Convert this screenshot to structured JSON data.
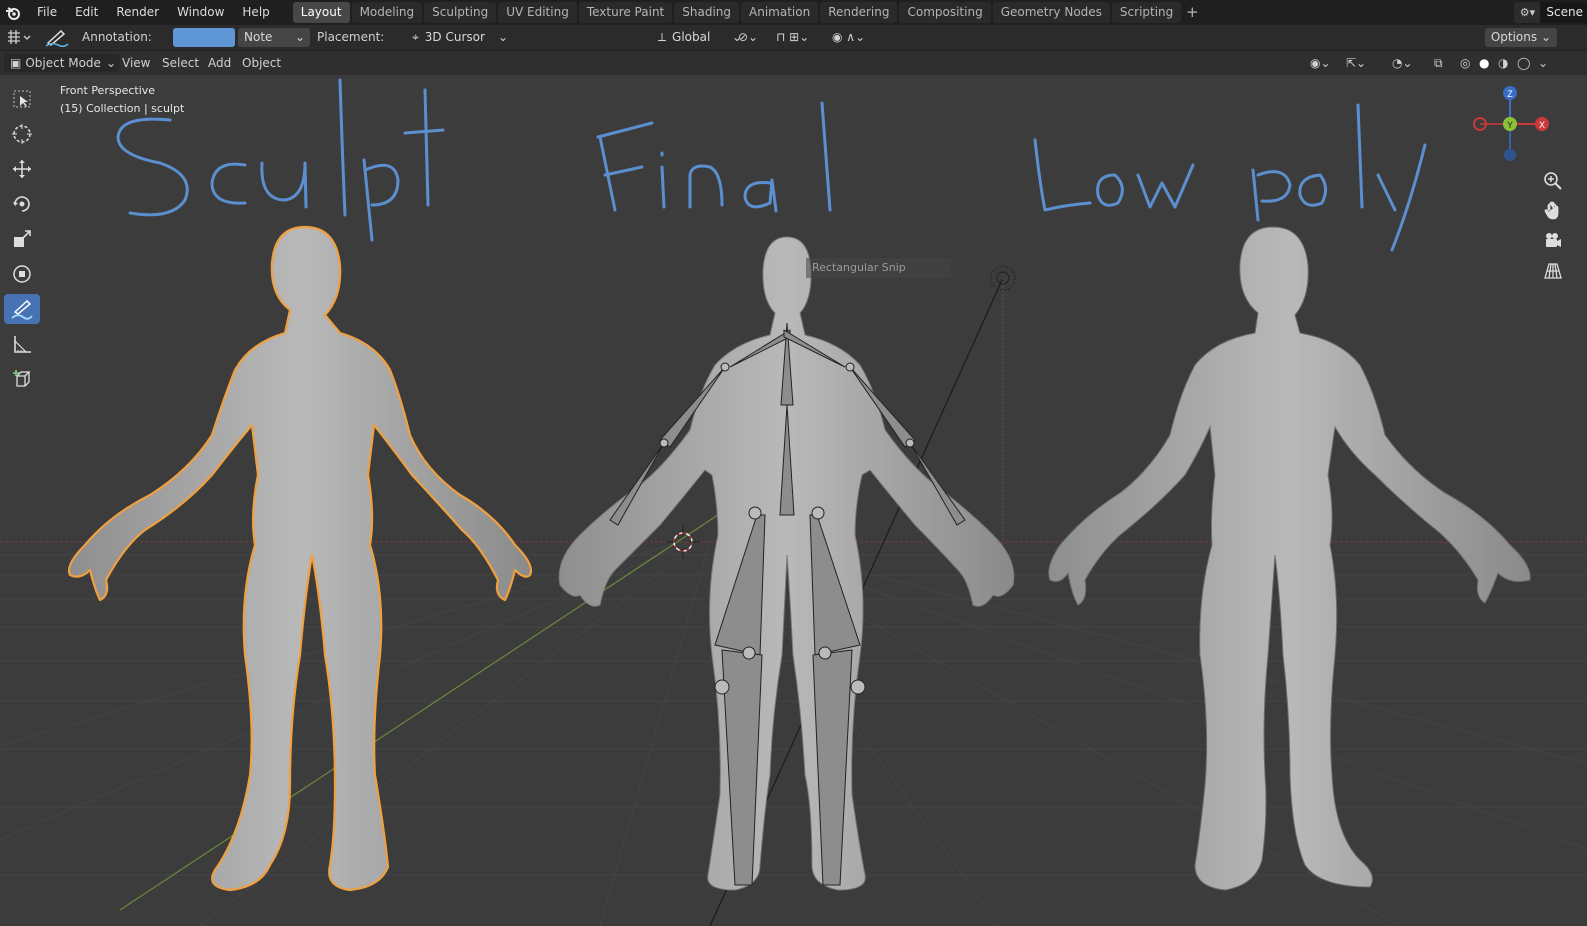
{
  "topbar": {
    "menu": [
      "File",
      "Edit",
      "Render",
      "Window",
      "Help"
    ],
    "workspaces": [
      "Layout",
      "Modeling",
      "Sculpting",
      "UV Editing",
      "Texture Paint",
      "Shading",
      "Animation",
      "Rendering",
      "Compositing",
      "Geometry Nodes",
      "Scripting"
    ],
    "active_workspace": "Layout",
    "scene_label": "Scene"
  },
  "toolsettings": {
    "annotation_label": "Annotation:",
    "annotation_color": "#5f97d6",
    "note_value": "Note",
    "placement_label": "Placement:",
    "placement_value": "3D Cursor",
    "orientation_value": "Global",
    "options_label": "Options"
  },
  "header3d": {
    "mode": "Object Mode",
    "menus": [
      "View",
      "Select",
      "Add",
      "Object"
    ]
  },
  "viewport": {
    "view_name": "Front Perspective",
    "collection_info": "(15) Collection | sculpt",
    "annotations": [
      "Sculpt",
      "Final",
      "Low poly"
    ],
    "tooltip": "Rectangular Snip",
    "annotation_color": "#5b8fcf",
    "selection_outline_color": "#f0a040",
    "gizmo_axes": [
      "X",
      "Y",
      "Z"
    ]
  }
}
